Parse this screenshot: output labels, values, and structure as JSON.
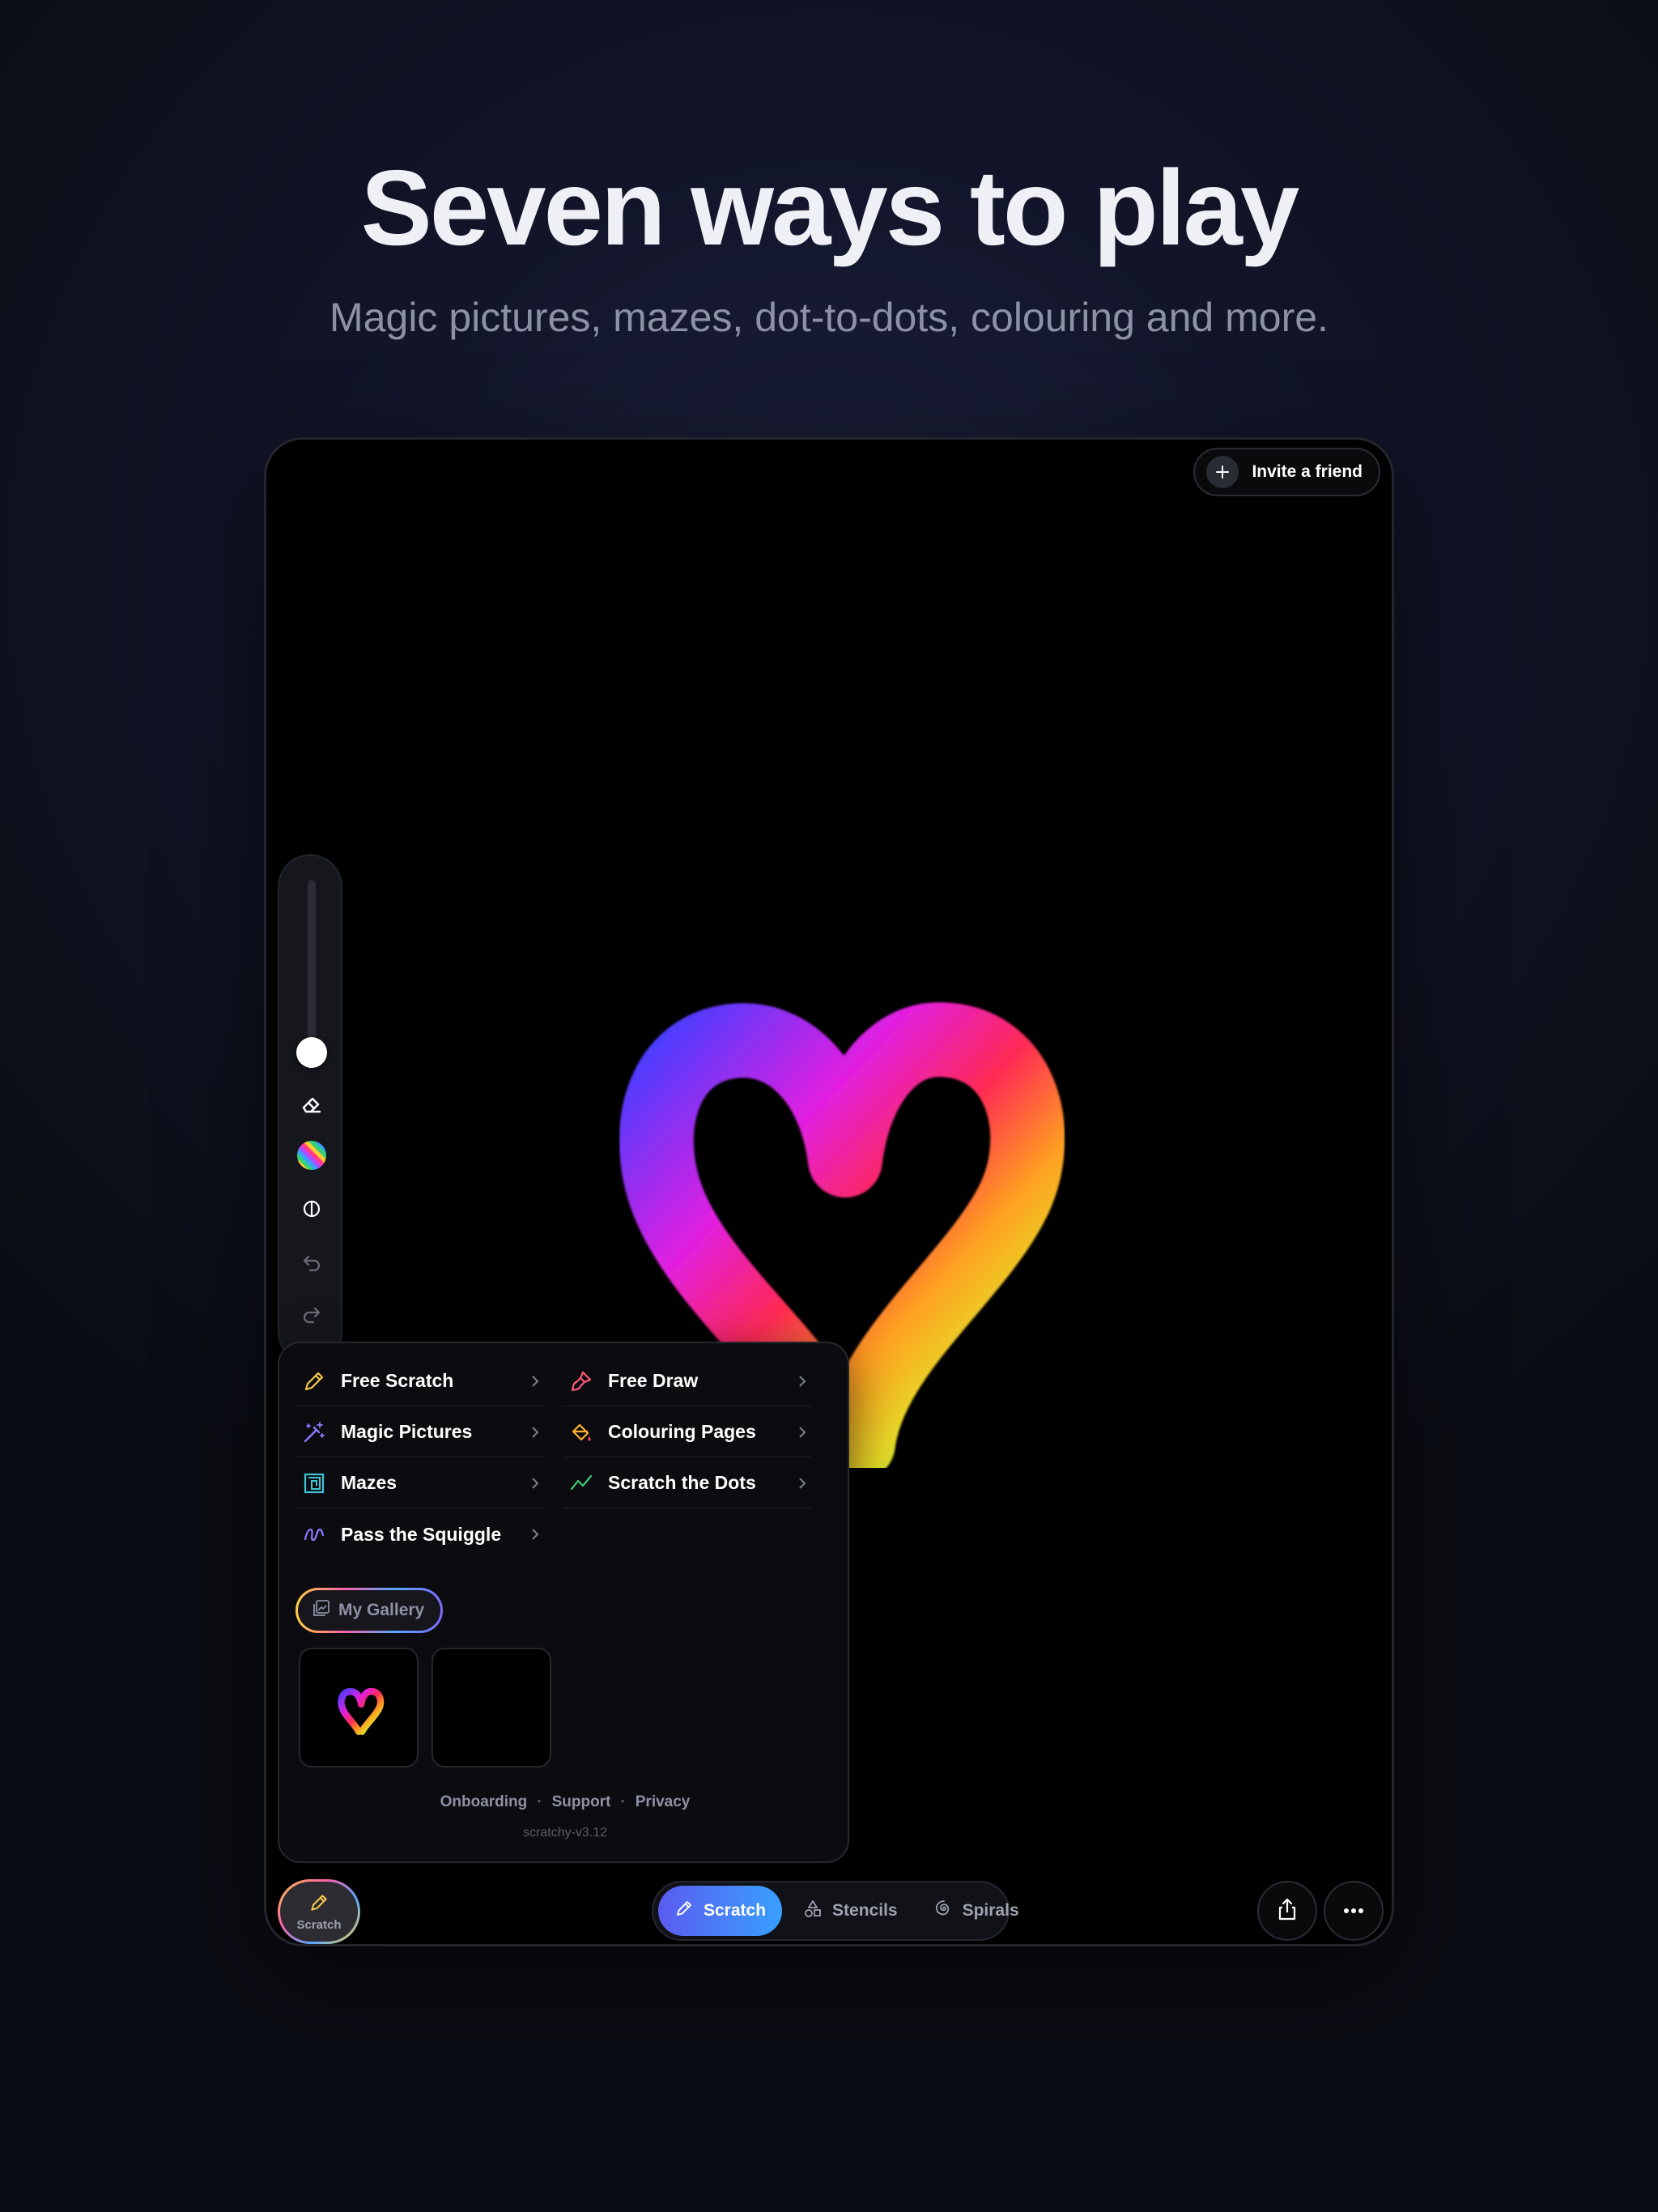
{
  "hero": {
    "title": "Seven ways to play",
    "subtitle": "Magic pictures, mazes, dot-to-dots, colouring and more."
  },
  "device": {
    "invite_label": "Invite a friend",
    "toolbar": {
      "brush_size": 0.12,
      "tools": [
        "eraser-icon",
        "color-palette-icon",
        "symmetry-icon",
        "undo-icon",
        "redo-icon"
      ]
    },
    "menu": {
      "modes": [
        {
          "label": "Free Scratch",
          "icon": "pencil-icon"
        },
        {
          "label": "Free Draw",
          "icon": "paintbrush-icon"
        },
        {
          "label": "Magic Pictures",
          "icon": "magic-wand-icon"
        },
        {
          "label": "Colouring Pages",
          "icon": "paint-bucket-icon"
        },
        {
          "label": "Mazes",
          "icon": "maze-icon"
        },
        {
          "label": "Scratch the Dots",
          "icon": "dot-line-icon"
        },
        {
          "label": "Pass the Squiggle",
          "icon": "squiggle-icon"
        }
      ],
      "gallery_label": "My Gallery",
      "footer_links": [
        "Onboarding",
        "Support",
        "Privacy"
      ],
      "version": "scratchy-v3.12"
    },
    "bottom": {
      "scratch_fab_label": "Scratch",
      "tabs": [
        "Scratch",
        "Stencils",
        "Spirals"
      ],
      "active_tab": "Scratch"
    }
  },
  "colors": {
    "background": "#0b0d14",
    "tab_active_start": "#5b5cf0",
    "tab_active_end": "#38a0ff"
  }
}
